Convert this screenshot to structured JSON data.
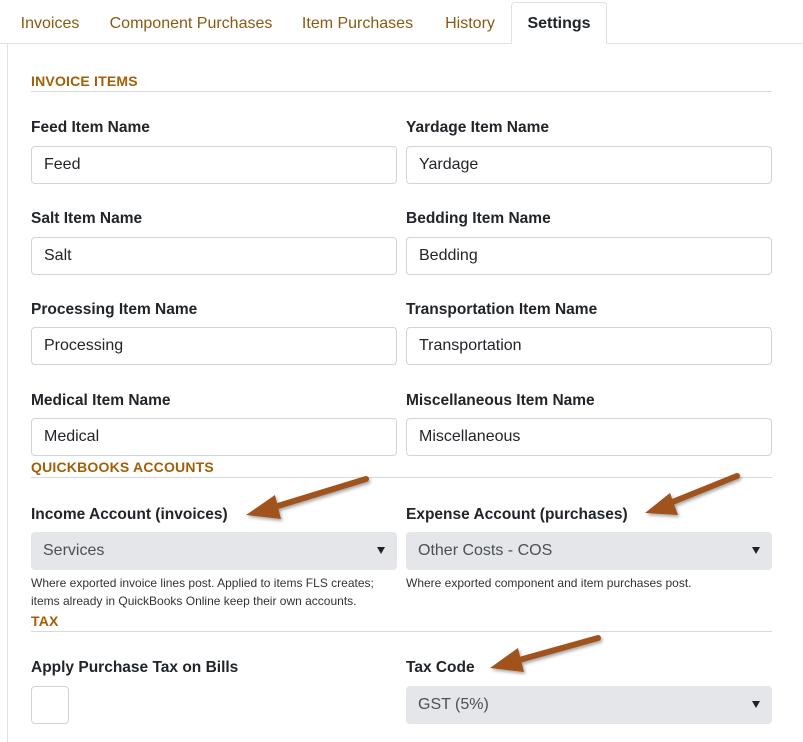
{
  "tabs": [
    {
      "label": "Invoices"
    },
    {
      "label": "Component Purchases"
    },
    {
      "label": "Item Purchases"
    },
    {
      "label": "History"
    },
    {
      "label": "Settings"
    }
  ],
  "sections": {
    "invoice_items": "INVOICE ITEMS",
    "quickbooks_accounts": "QUICKBOOKS ACCOUNTS",
    "tax": "TAX"
  },
  "invoice_items": {
    "feed": {
      "label": "Feed Item Name",
      "value": "Feed"
    },
    "yardage": {
      "label": "Yardage Item Name",
      "value": "Yardage"
    },
    "salt": {
      "label": "Salt Item Name",
      "value": "Salt"
    },
    "bedding": {
      "label": "Bedding Item Name",
      "value": "Bedding"
    },
    "processing": {
      "label": "Processing Item Name",
      "value": "Processing"
    },
    "transportation": {
      "label": "Transportation Item Name",
      "value": "Transportation"
    },
    "medical": {
      "label": "Medical Item Name",
      "value": "Medical"
    },
    "miscellaneous": {
      "label": "Miscellaneous Item Name",
      "value": "Miscellaneous"
    }
  },
  "accounts": {
    "income": {
      "label": "Income Account (invoices)",
      "selected": "Services",
      "help_line1": "Where exported invoice lines post. Applied to items FLS creates;",
      "help_line2": "items already in QuickBooks Online keep their own accounts."
    },
    "expense": {
      "label": "Expense Account (purchases)",
      "selected": "Other Costs - COS",
      "help": "Where exported component and item purchases post."
    }
  },
  "tax": {
    "apply_label": "Apply Purchase Tax on Bills",
    "apply_checked": false,
    "code_label": "Tax Code",
    "code_selected": "GST (5%)"
  },
  "colors": {
    "accent": "#a25f05",
    "tab_link": "#8a5a12",
    "arrow": "#a0521d"
  }
}
